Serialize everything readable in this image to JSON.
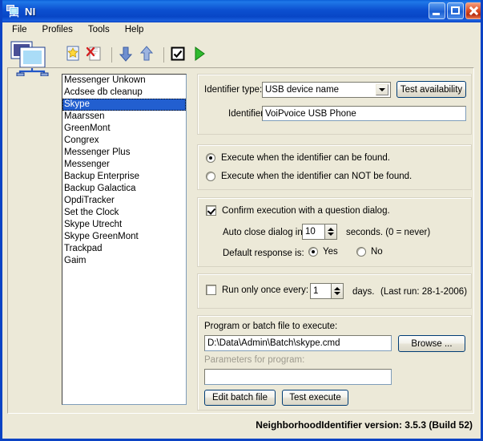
{
  "window": {
    "title": "NI",
    "icon": "network-computers-icon",
    "buttons": {
      "minimize": "minimize",
      "maximize": "maximize",
      "close": "close"
    }
  },
  "menu": {
    "items": [
      "File",
      "Profiles",
      "Tools",
      "Help"
    ]
  },
  "toolbar": {
    "items": [
      {
        "name": "new-profile-icon",
        "tip": "New"
      },
      {
        "name": "delete-profile-icon",
        "tip": "Delete"
      },
      {
        "name": "move-down-icon",
        "tip": "Move down"
      },
      {
        "name": "move-up-icon",
        "tip": "Move up"
      },
      {
        "name": "enable-checkbox-icon",
        "tip": "Enable"
      },
      {
        "name": "run-icon",
        "tip": "Run"
      }
    ]
  },
  "profile_list": {
    "items": [
      "Messenger Unkown",
      "Acdsee db cleanup",
      "Skype",
      "Maarssen",
      "GreenMont",
      "Congrex",
      "Messenger Plus",
      "Messenger",
      "Backup Enterprise",
      "Backup Galactica",
      "OpdiTracker",
      "Set the Clock",
      "Skype Utrecht",
      "Skype GreenMont",
      "Trackpad",
      "Gaim"
    ],
    "selected_index": 2
  },
  "identifier_panel": {
    "type_label": "Identifier type:",
    "type_value": "USB device name",
    "type_options": [
      "USB device name"
    ],
    "test_button": "Test availability",
    "identifier_label": "Identifier",
    "identifier_value": "VoiPvoice USB Phone"
  },
  "execute_condition": {
    "options": [
      "Execute when the identifier can be found.",
      "Execute when the identifier can NOT be found."
    ],
    "selected_index": 0
  },
  "confirm_panel": {
    "confirm_label": "Confirm execution with a question dialog.",
    "confirm_checked": true,
    "auto_close_label": "Auto close dialog in:",
    "auto_close_value": "10",
    "seconds_label": "seconds. (0 = never)",
    "default_response_label": "Default response is:",
    "yes_label": "Yes",
    "no_label": "No",
    "default_response_selected": "Yes"
  },
  "run_once_panel": {
    "label": "Run only once every:",
    "checked": false,
    "value": "1",
    "days_label": "days.",
    "last_run_label": "(Last run: 28-1-2006)"
  },
  "program_panel": {
    "title": "Program or batch file to execute:",
    "path_value": "D:\\Data\\Admin\\Batch\\skype.cmd",
    "browse_button": "Browse ...",
    "parameters_label": "Parameters for program:",
    "parameters_value": "",
    "edit_button": "Edit batch file",
    "test_button": "Test execute"
  },
  "footer": {
    "version_text": "NeighborhoodIdentifier version: 3.5.3 (Build 52)"
  },
  "colors": {
    "window_face": "#ece9d8",
    "title_blue": "#0b4fd0",
    "selection_blue": "#225fd0",
    "button_border": "#003c74",
    "disabled_text": "#9d9a8e"
  }
}
